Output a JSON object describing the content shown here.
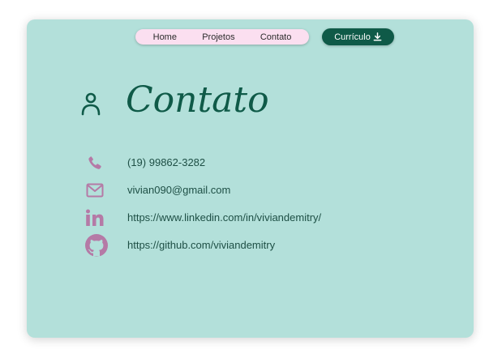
{
  "nav": {
    "items": [
      {
        "label": "Home"
      },
      {
        "label": "Projetos"
      },
      {
        "label": "Contato"
      }
    ]
  },
  "cv_button": {
    "label": "Currículo",
    "icon": "download-icon"
  },
  "page": {
    "title": "Contato",
    "title_icon": "person-icon"
  },
  "contacts": [
    {
      "icon": "phone-icon",
      "text": "(19) 99862-3282"
    },
    {
      "icon": "mail-icon",
      "text": "vivian090@gmail.com"
    },
    {
      "icon": "linkedin-icon",
      "text": "https://www.linkedin.com/in/viviandemitry/"
    },
    {
      "icon": "github-icon",
      "text": "https://github.com/viviandemitry"
    }
  ],
  "colors": {
    "card_bg": "#b3e0da",
    "nav_bg": "#fbdff0",
    "accent_dark": "#0f5a48",
    "icon_pink": "#b57aa6"
  }
}
